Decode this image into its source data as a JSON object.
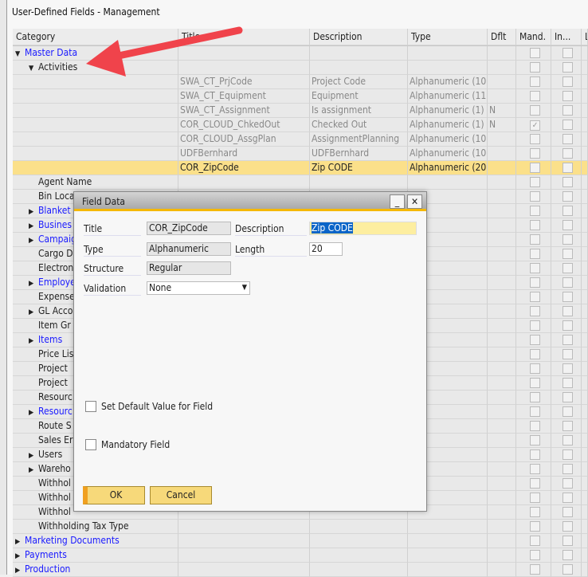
{
  "window": {
    "title": "User-Defined Fields - Management"
  },
  "columns": [
    "Category",
    "Title",
    "Description",
    "Type",
    "Dflt",
    "Mand.",
    "In...",
    "L"
  ],
  "rows": [
    {
      "cat": "Master Data",
      "level": 0,
      "expander": "down",
      "blue": true
    },
    {
      "cat": "Activities",
      "level": 1,
      "expander": "down"
    },
    {
      "cat": "",
      "title": "SWA_CT_PrjCode",
      "desc": "Project Code",
      "type": "Alphanumeric (10",
      "dflt": "",
      "mand": false,
      "muted": true
    },
    {
      "cat": "",
      "title": "SWA_CT_Equipment",
      "desc": "Equipment",
      "type": "Alphanumeric (11",
      "dflt": "",
      "mand": false,
      "muted": true
    },
    {
      "cat": "",
      "title": "SWA_CT_Assignment",
      "desc": "Is assignment",
      "type": "Alphanumeric (1)",
      "dflt": "N",
      "mand": false,
      "muted": true
    },
    {
      "cat": "",
      "title": "COR_CLOUD_ChkedOut",
      "desc": "Checked Out",
      "type": "Alphanumeric (1)",
      "dflt": "N",
      "mand": true,
      "muted": true
    },
    {
      "cat": "",
      "title": "COR_CLOUD_AssgPlan",
      "desc": "AssignmentPlanning",
      "type": "Alphanumeric (10",
      "dflt": "",
      "mand": false,
      "muted": true
    },
    {
      "cat": "",
      "title": "UDFBernhard",
      "desc": "UDFBernhard",
      "type": "Alphanumeric (10",
      "dflt": "",
      "mand": false,
      "muted": true
    },
    {
      "cat": "",
      "title": "COR_ZipCode",
      "desc": "Zip CODE",
      "type": "Alphanumeric (20",
      "dflt": "",
      "mand": false,
      "selected": true
    },
    {
      "cat": "Agent Name",
      "level": 1
    },
    {
      "cat": "Bin Loca",
      "level": 1
    },
    {
      "cat": "Blanket",
      "level": 1,
      "expander": "right",
      "blue": true
    },
    {
      "cat": "Busines",
      "level": 1,
      "expander": "right",
      "blue": true
    },
    {
      "cat": "Campaig",
      "level": 1,
      "expander": "right",
      "blue": true
    },
    {
      "cat": "Cargo D",
      "level": 1
    },
    {
      "cat": "Electron",
      "level": 1
    },
    {
      "cat": "Employe",
      "level": 1,
      "expander": "right",
      "blue": true
    },
    {
      "cat": "Expense",
      "level": 1
    },
    {
      "cat": "GL Acco",
      "level": 1,
      "expander": "right"
    },
    {
      "cat": "Item Gr",
      "level": 1
    },
    {
      "cat": "Items",
      "level": 1,
      "expander": "right",
      "blue": true
    },
    {
      "cat": "Price Lis",
      "level": 1
    },
    {
      "cat": "Project",
      "level": 1
    },
    {
      "cat": "Project",
      "level": 1
    },
    {
      "cat": "Resourc",
      "level": 1
    },
    {
      "cat": "Resourc",
      "level": 1,
      "expander": "right",
      "blue": true
    },
    {
      "cat": "Route S",
      "level": 1
    },
    {
      "cat": "Sales Er",
      "level": 1
    },
    {
      "cat": "Users",
      "level": 1,
      "expander": "right"
    },
    {
      "cat": "Wareho",
      "level": 1,
      "expander": "right"
    },
    {
      "cat": "Withhol",
      "level": 1
    },
    {
      "cat": "Withhol",
      "level": 1
    },
    {
      "cat": "Withhol",
      "level": 1
    },
    {
      "cat": "Withholding Tax Type",
      "level": 1
    },
    {
      "cat": "Marketing Documents",
      "level": 0,
      "expander": "right",
      "blue": true
    },
    {
      "cat": "Payments",
      "level": 0,
      "expander": "right",
      "blue": true
    },
    {
      "cat": "Production",
      "level": 0,
      "expander": "right",
      "blue": true
    }
  ],
  "dialog": {
    "title": "Field Data",
    "title_label": "Title",
    "title_value": "COR_ZipCode",
    "type_label": "Type",
    "type_value": "Alphanumeric",
    "structure_label": "Structure",
    "structure_value": "Regular",
    "validation_label": "Validation",
    "validation_value": "None",
    "description_label": "Description",
    "description_value": "Zip CODE",
    "length_label": "Length",
    "length_value": "20",
    "default_checkbox": "Set Default Value for Field",
    "default_checked": false,
    "mandatory_checkbox": "Mandatory Field",
    "mandatory_checked": false,
    "ok": "OK",
    "cancel": "Cancel"
  },
  "colors": {
    "selected_row": "#fbe08a",
    "accent": "#f5b800",
    "link": "#1a1aff",
    "arrow": "#f0434b"
  }
}
